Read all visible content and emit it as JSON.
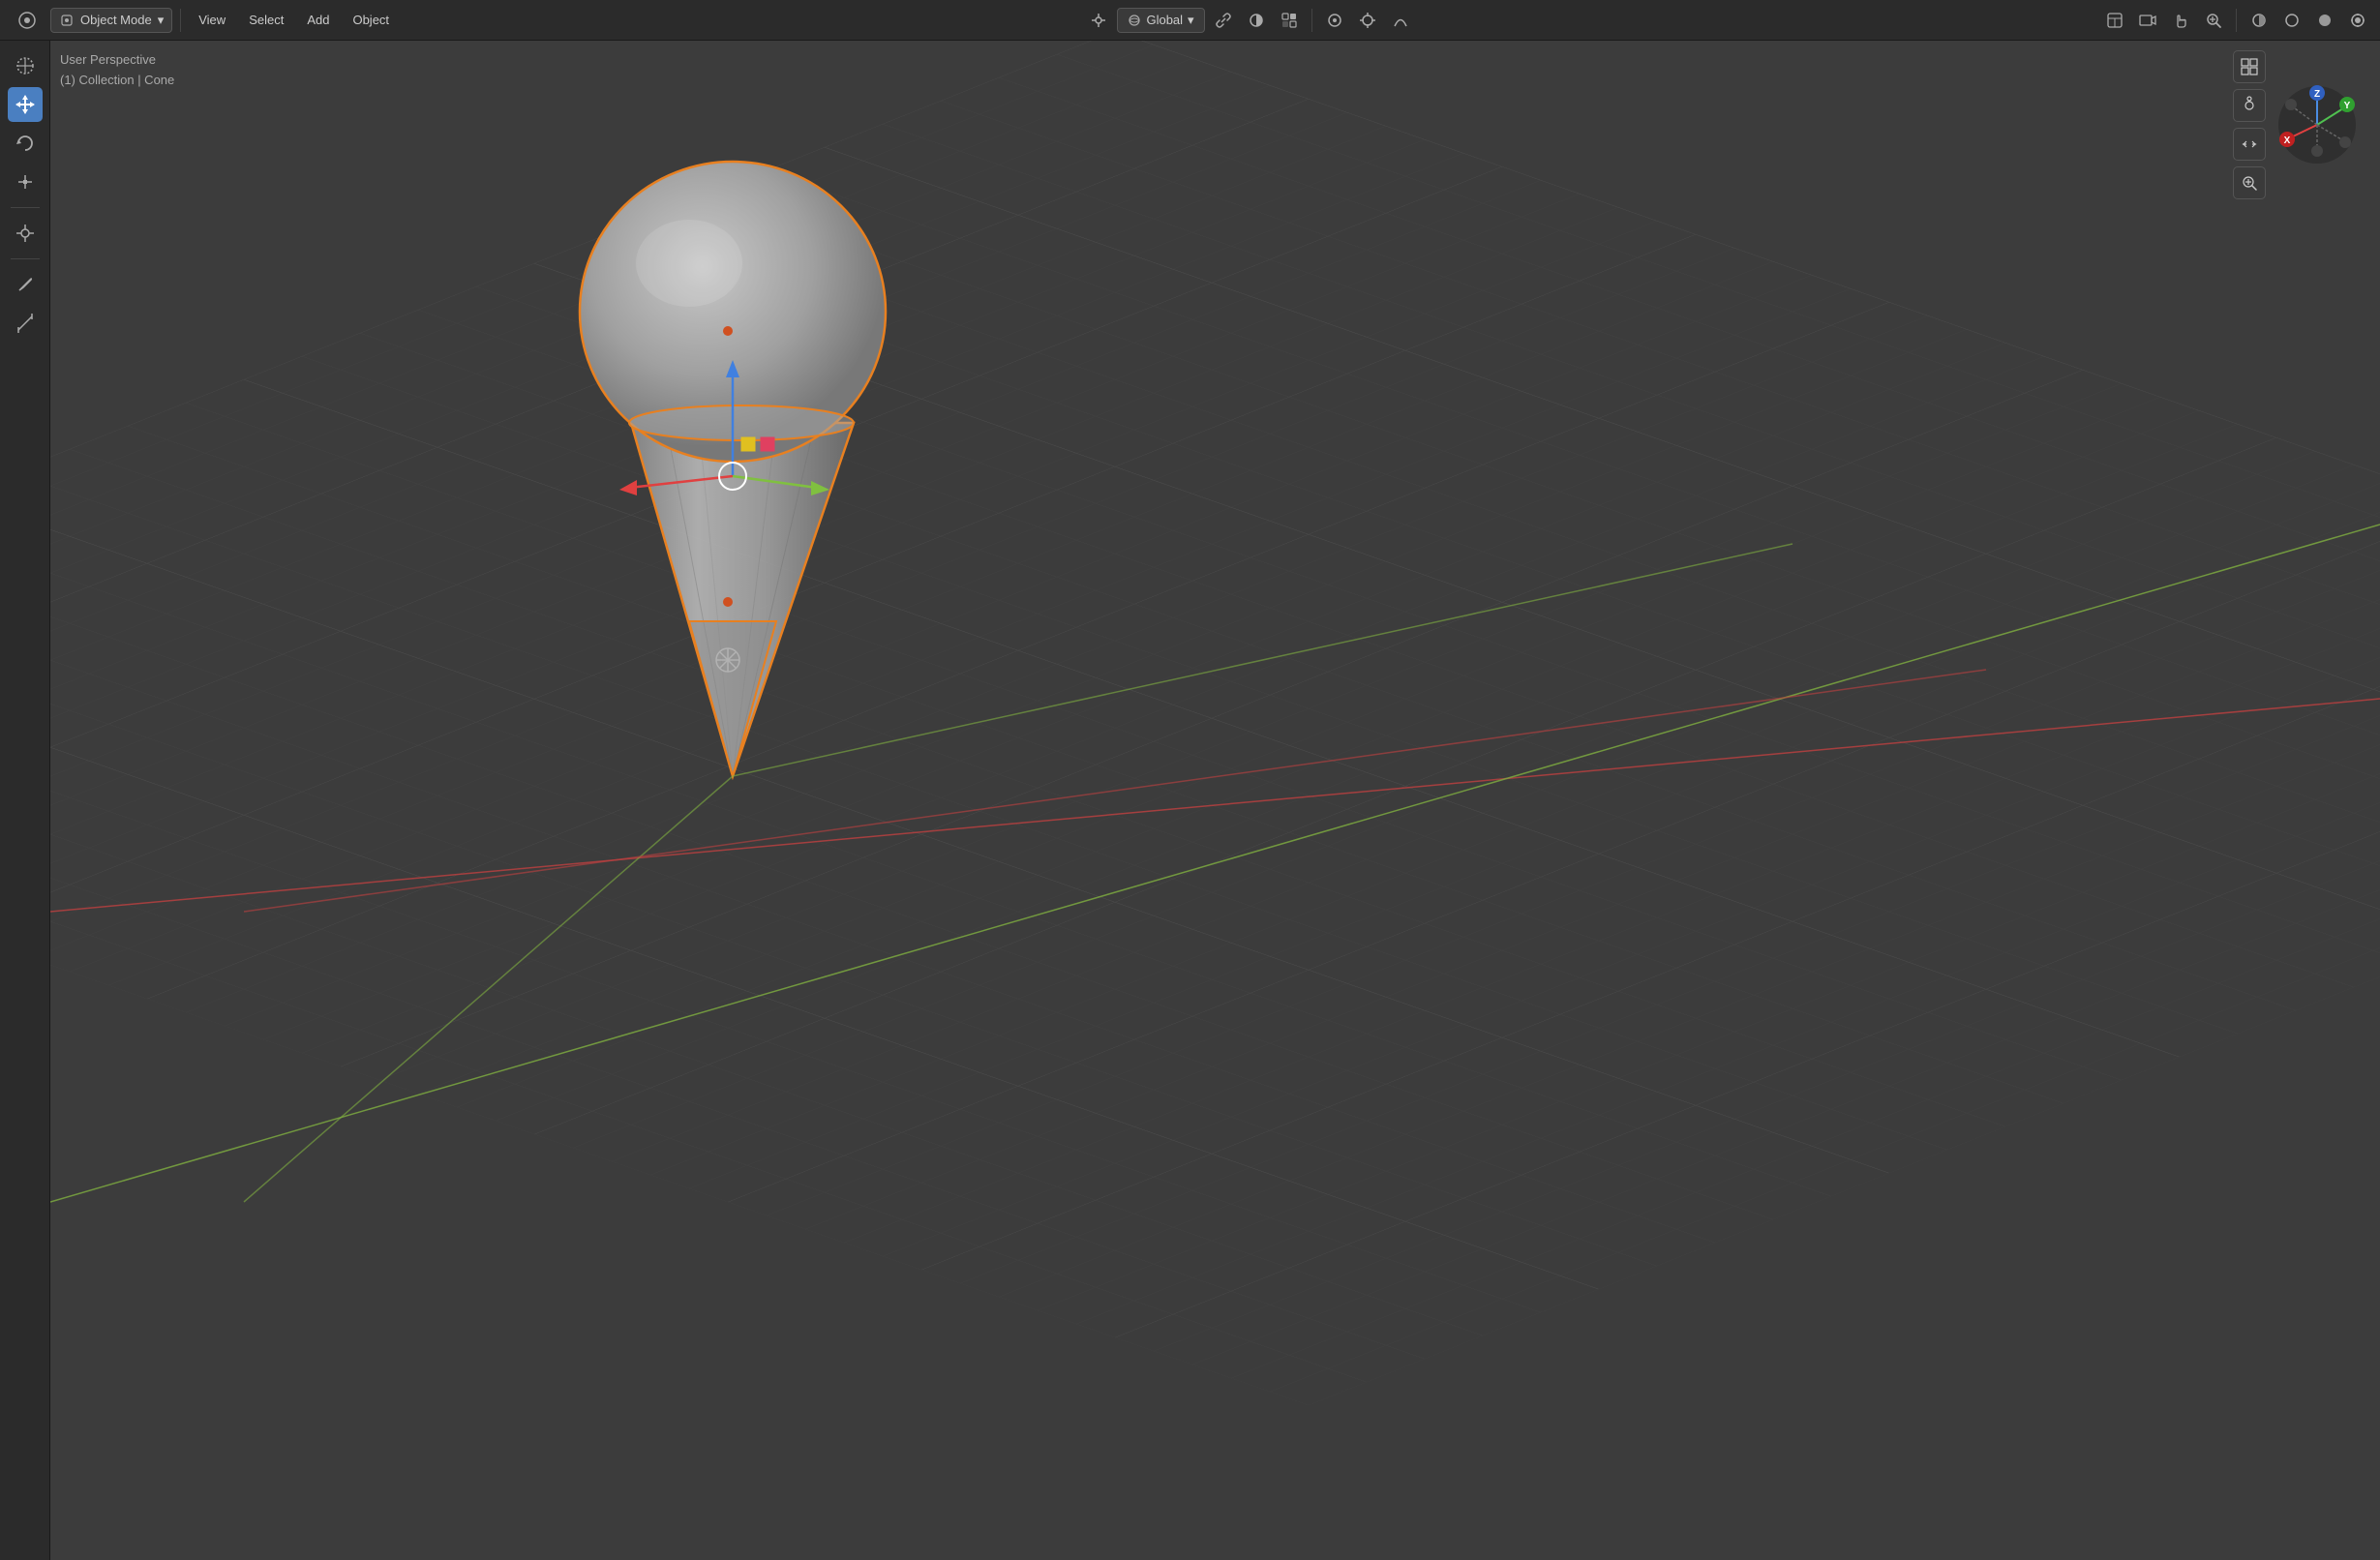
{
  "topbar": {
    "blender_icon": "⚙",
    "object_mode_label": "Object Mode",
    "view_label": "View",
    "select_label": "Select",
    "add_label": "Add",
    "object_label": "Object",
    "global_label": "Global",
    "link_icon": "🔗",
    "overlay_icon": "⬤",
    "viewport_shading_icon": "◑",
    "proportional_icon": "⊙",
    "snap_icon": "🧲",
    "right_icons": [
      "⊞",
      "🎥",
      "✋",
      "🔍"
    ]
  },
  "viewport_info": {
    "line1": "User Perspective",
    "line2": "(1) Collection | Cone"
  },
  "tools": [
    {
      "name": "cursor",
      "icon": "✛",
      "active": false
    },
    {
      "name": "move",
      "icon": "⊕",
      "active": true
    },
    {
      "name": "rotate",
      "icon": "↺",
      "active": false
    },
    {
      "name": "scale",
      "icon": "⤡",
      "active": false
    },
    {
      "name": "transform",
      "icon": "✦",
      "active": false
    },
    {
      "name": "annotate",
      "icon": "✏",
      "active": false
    },
    {
      "name": "measure",
      "icon": "📐",
      "active": false
    }
  ],
  "gizmo": {
    "x_label": "X",
    "y_label": "Y",
    "z_label": "Z",
    "x_color": "#e04040",
    "y_color": "#80c080",
    "z_color": "#4080e0"
  },
  "scene": {
    "grid_color": "#4a4a4a",
    "grid_x_axis_color": "#c04040",
    "grid_y_axis_color": "#80b040"
  }
}
